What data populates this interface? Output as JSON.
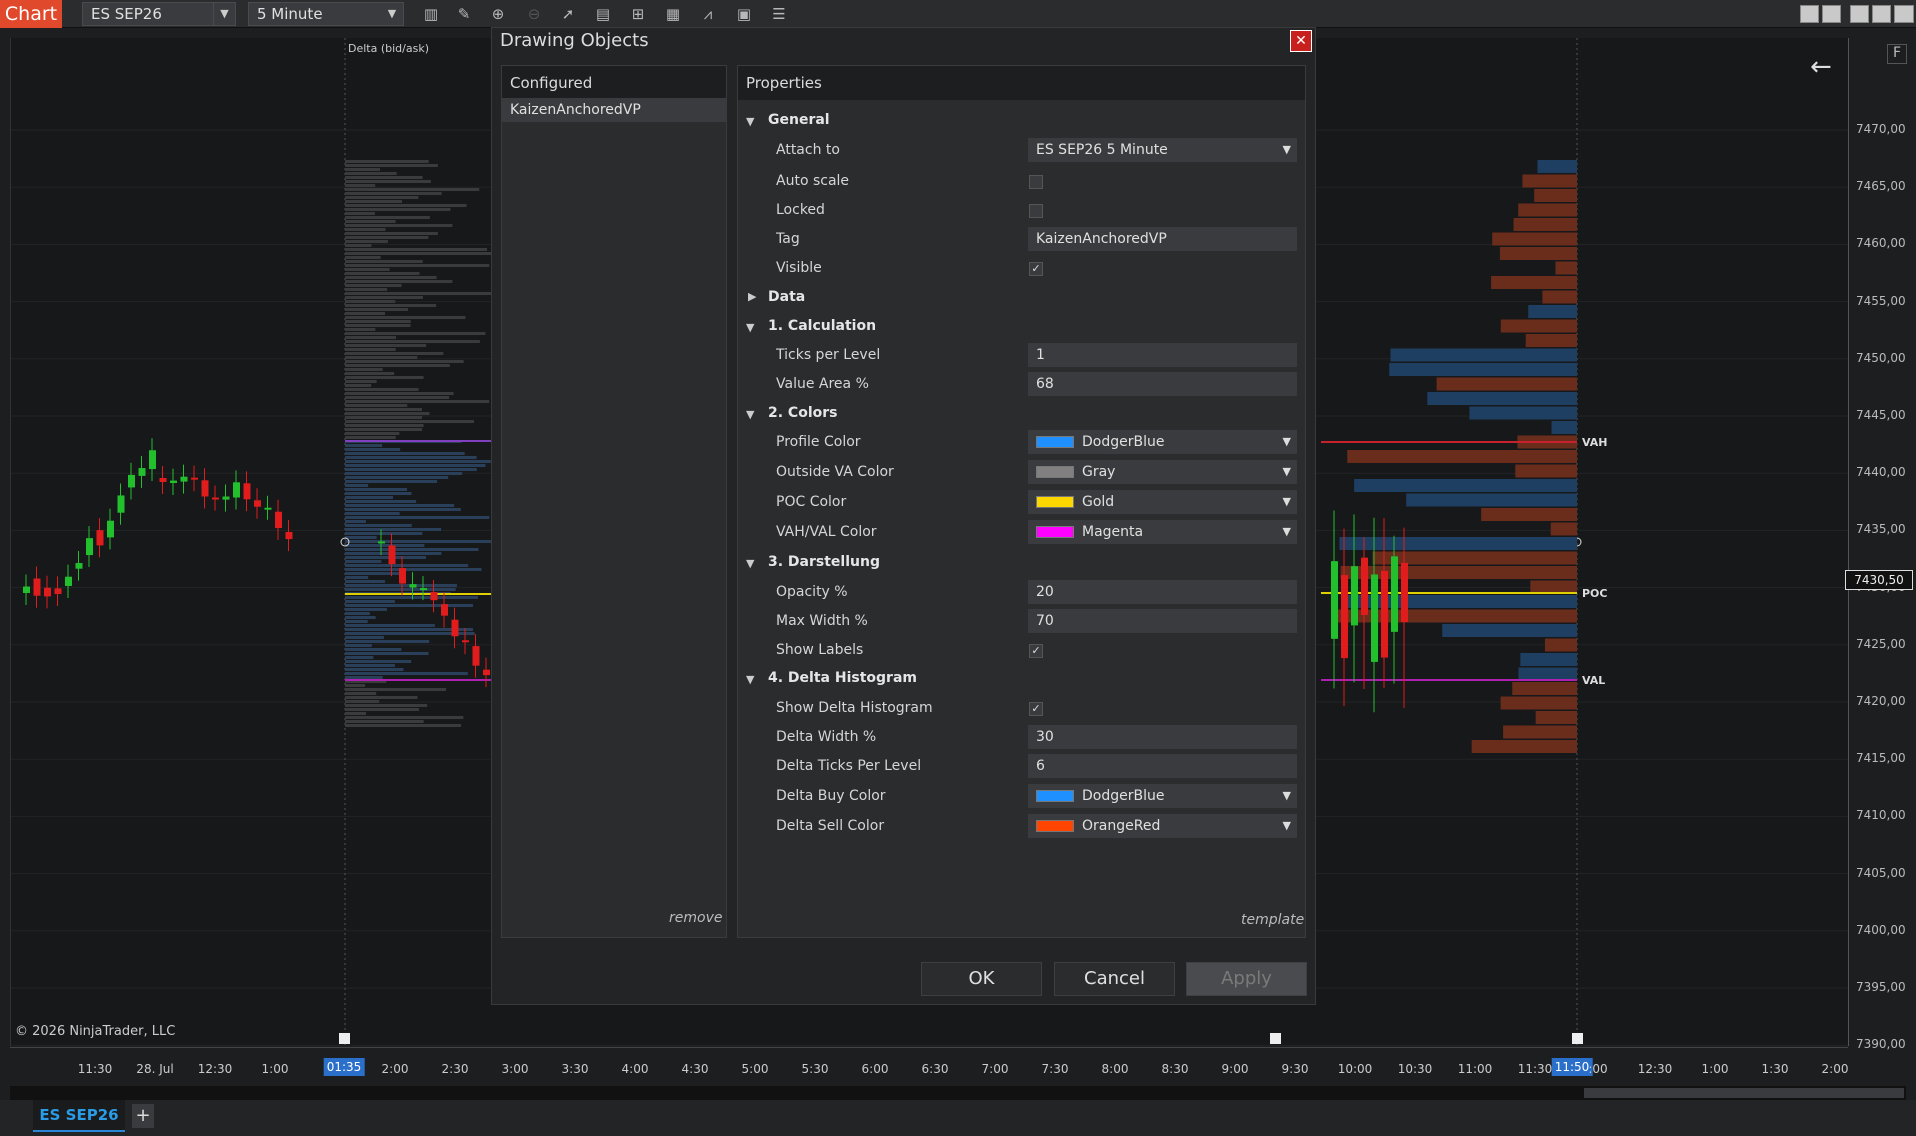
{
  "toolbar": {
    "chart_label": "Chart",
    "instrument": "ES SEP26",
    "interval": "5 Minute"
  },
  "chart": {
    "copyright": "© 2026 NinjaTrader, LLC",
    "delta_label": "Delta (bid/ask)",
    "f_label": "F",
    "price_ticks": [
      "7470,00",
      "7465,00",
      "7460,00",
      "7455,00",
      "7450,00",
      "7445,00",
      "7440,00",
      "7435,00",
      "7430,00",
      "7425,00",
      "7420,00",
      "7415,00",
      "7410,00",
      "7405,00",
      "7400,00",
      "7395,00",
      "7390,00"
    ],
    "current_price": "7430,50",
    "time_labels": [
      "11:30",
      "28. Jul",
      "12:30",
      "1:00",
      "01:35",
      "2:00",
      "2:30",
      "3:00",
      "3:30",
      "4:00",
      "4:30",
      "5:00",
      "5:30",
      "6:00",
      "6:30",
      "7:00",
      "7:30",
      "8:00",
      "8:30",
      "9:00",
      "9:30",
      "10:00",
      "10:30",
      "11:00",
      "11:30",
      "11:50",
      ":00",
      "12:30",
      "1:00",
      "1:30",
      "2:00"
    ],
    "levels": {
      "vah": "VAH",
      "poc": "POC",
      "val": "VAL"
    },
    "colors": {
      "buy": "#2a5a8a",
      "sell": "#8a3a22",
      "poc": "#e0d000",
      "vaval": "#b020b0"
    }
  },
  "dialog": {
    "title": "Drawing Objects",
    "configured_header": "Configured",
    "configured_item": "KaizenAnchoredVP",
    "remove": "remove",
    "properties_header": "Properties",
    "template": "template",
    "buttons": {
      "ok": "OK",
      "cancel": "Cancel",
      "apply": "Apply"
    },
    "categories": {
      "general": "General",
      "data": "Data",
      "calc": "1. Calculation",
      "colors": "2. Colors",
      "darstellung": "3. Darstellung",
      "delta": "4. Delta Histogram"
    },
    "props": {
      "attach_to": {
        "label": "Attach to",
        "value": "ES SEP26 5 Minute"
      },
      "auto_scale": {
        "label": "Auto scale"
      },
      "locked": {
        "label": "Locked"
      },
      "tag": {
        "label": "Tag",
        "value": "KaizenAnchoredVP"
      },
      "visible": {
        "label": "Visible"
      },
      "ticks_per_level": {
        "label": "Ticks per Level",
        "value": "1"
      },
      "value_area": {
        "label": "Value Area %",
        "value": "68"
      },
      "profile_color": {
        "label": "Profile Color",
        "value": "DodgerBlue",
        "swatch": "#1e90ff"
      },
      "outside_va_color": {
        "label": "Outside VA Color",
        "value": "Gray",
        "swatch": "#808080"
      },
      "poc_color": {
        "label": "POC Color",
        "value": "Gold",
        "swatch": "#ffd700"
      },
      "vahval_color": {
        "label": "VAH/VAL Color",
        "value": "Magenta",
        "swatch": "#ff00ff"
      },
      "opacity": {
        "label": "Opacity %",
        "value": "20"
      },
      "max_width": {
        "label": "Max Width %",
        "value": "70"
      },
      "show_labels": {
        "label": "Show Labels"
      },
      "show_delta": {
        "label": "Show Delta Histogram"
      },
      "delta_width": {
        "label": "Delta Width %",
        "value": "30"
      },
      "delta_ticks": {
        "label": "Delta Ticks Per Level",
        "value": "6"
      },
      "delta_buy": {
        "label": "Delta Buy Color",
        "value": "DodgerBlue",
        "swatch": "#1e90ff"
      },
      "delta_sell": {
        "label": "Delta Sell Color",
        "value": "OrangeRed",
        "swatch": "#ff4500"
      }
    },
    "check_mark": "✓"
  },
  "tabs": {
    "active": "ES SEP26",
    "add": "+"
  }
}
